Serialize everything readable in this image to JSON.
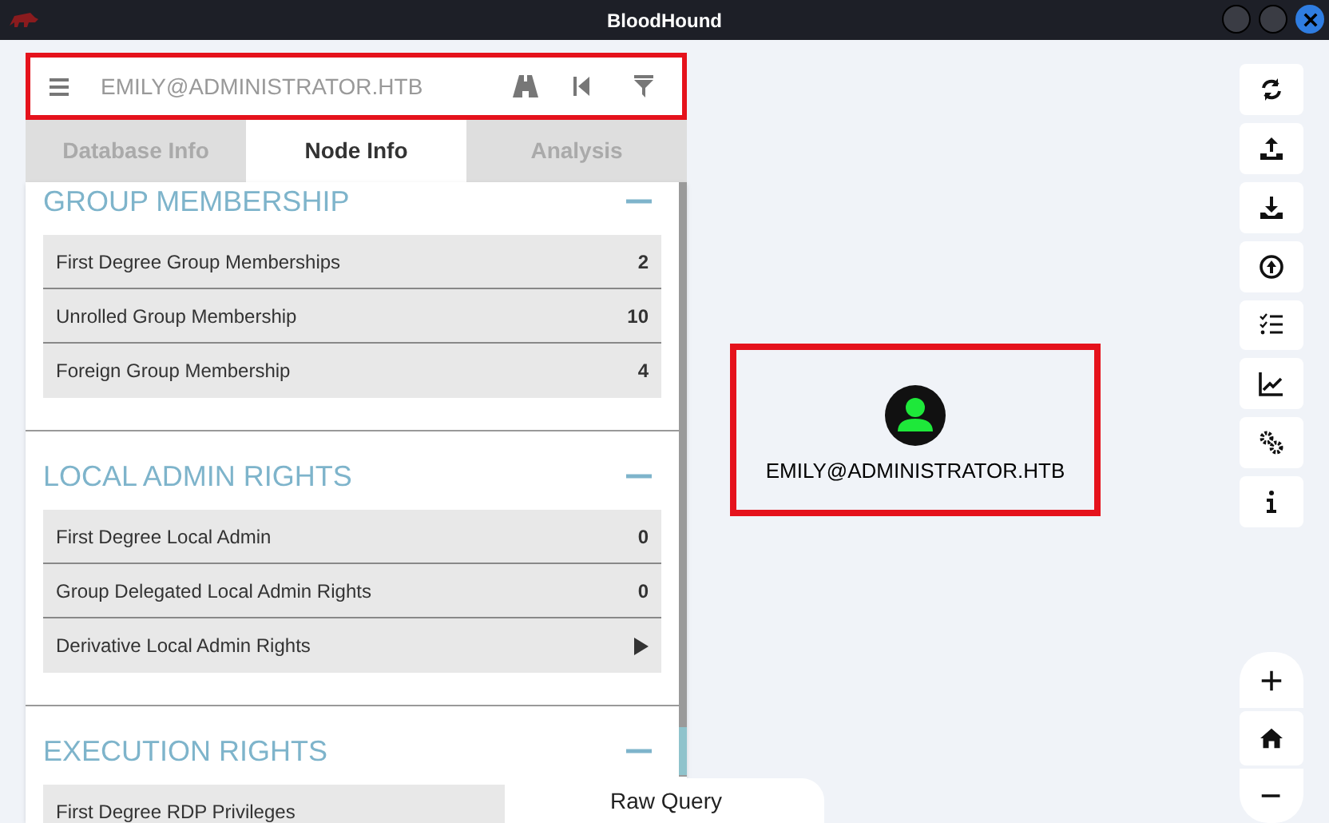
{
  "window": {
    "title": "BloodHound"
  },
  "search": {
    "value": "EMILY@ADMINISTRATOR.HTB",
    "highlighted": true
  },
  "tabs": [
    {
      "label": "Database Info",
      "selected": false
    },
    {
      "label": "Node Info",
      "selected": true
    },
    {
      "label": "Analysis",
      "selected": false
    }
  ],
  "sections": [
    {
      "title": "GROUP MEMBERSHIP",
      "expanded": true,
      "rows": [
        {
          "label": "First Degree Group Memberships",
          "kind": "count",
          "value": "2"
        },
        {
          "label": "Unrolled Group Membership",
          "kind": "count",
          "value": "10"
        },
        {
          "label": "Foreign Group Membership",
          "kind": "count",
          "value": "4"
        }
      ]
    },
    {
      "title": "LOCAL ADMIN RIGHTS",
      "expanded": true,
      "rows": [
        {
          "label": "First Degree Local Admin",
          "kind": "count",
          "value": "0"
        },
        {
          "label": "Group Delegated Local Admin Rights",
          "kind": "count",
          "value": "0"
        },
        {
          "label": "Derivative Local Admin Rights",
          "kind": "expand"
        }
      ]
    },
    {
      "title": "EXECUTION RIGHTS",
      "expanded": true,
      "rows": [
        {
          "label": "First Degree RDP Privileges",
          "kind": "count"
        }
      ]
    }
  ],
  "graph": {
    "node": {
      "label": "EMILY@ADMINISTRATOR.HTB",
      "highlighted": true
    }
  },
  "raw_query": {
    "label": "Raw Query"
  }
}
